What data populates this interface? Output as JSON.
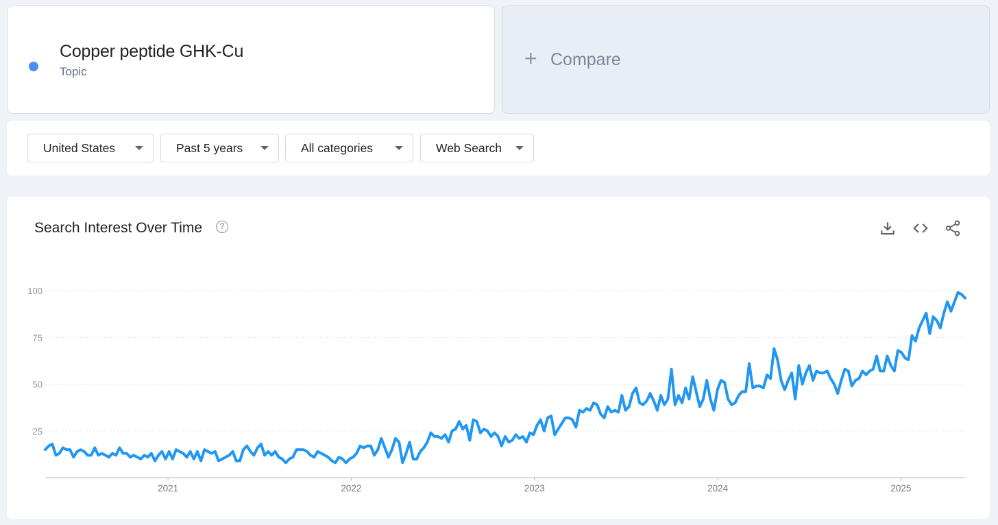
{
  "term": {
    "title": "Copper peptide GHK-Cu",
    "subtitle": "Topic",
    "color": "#4d8ef1"
  },
  "compare": {
    "plus": "+",
    "label": "Compare"
  },
  "filters": {
    "region": "United States",
    "period": "Past 5 years",
    "category": "All categories",
    "search_type": "Web Search"
  },
  "chart_header": {
    "title": "Search Interest Over Time",
    "help_icon": "question-circle-icon",
    "tools": [
      "download-icon",
      "embed-code-icon",
      "share-icon"
    ]
  },
  "chart_data": {
    "type": "line",
    "title": "Search Interest Over Time",
    "xlabel": "",
    "ylabel": "",
    "ylim": [
      0,
      100
    ],
    "yticks": [
      25,
      50,
      75,
      100
    ],
    "xticks": [
      "2021",
      "2022",
      "2023",
      "2024",
      "2025"
    ],
    "x_start": 2020.33,
    "x_end": 2025.35,
    "grid": true,
    "color": "#2196f3",
    "series": [
      {
        "values": [
          15,
          17,
          18,
          12,
          13,
          16,
          15,
          15,
          11,
          14,
          15,
          14,
          12,
          12,
          16,
          12,
          13,
          12,
          11,
          13,
          12,
          16,
          13,
          13,
          11,
          12,
          11,
          10,
          12,
          11,
          13,
          9,
          12,
          14,
          10,
          14,
          10,
          15,
          14,
          13,
          11,
          14,
          10,
          14,
          9,
          15,
          14,
          13,
          14,
          9,
          10,
          11,
          12,
          14,
          9,
          9,
          15,
          17,
          14,
          12,
          16,
          18,
          12,
          14,
          12,
          14,
          11,
          10,
          8,
          10,
          11,
          15,
          15,
          15,
          14,
          12,
          11,
          14,
          13,
          12,
          11,
          9,
          8,
          11,
          10,
          8,
          10,
          11,
          13,
          17,
          16,
          17,
          17,
          12,
          15,
          21,
          16,
          11,
          15,
          21,
          19,
          8,
          13,
          19,
          10,
          10,
          14,
          16,
          19,
          24,
          22,
          22,
          21,
          23,
          19,
          25,
          26,
          30,
          26,
          28,
          20,
          31,
          30,
          24,
          26,
          25,
          22,
          24,
          22,
          17,
          22,
          19,
          20,
          23,
          21,
          22,
          19,
          24,
          23,
          28,
          31,
          25,
          32,
          33,
          23,
          26,
          29,
          32,
          32,
          31,
          27,
          36,
          35,
          37,
          36,
          40,
          39,
          34,
          32,
          38,
          35,
          36,
          35,
          44,
          36,
          38,
          45,
          48,
          40,
          39,
          41,
          45,
          41,
          36,
          44,
          39,
          42,
          58,
          39,
          44,
          40,
          48,
          42,
          54,
          46,
          38,
          42,
          52,
          42,
          36,
          47,
          52,
          51,
          42,
          39,
          40,
          44,
          46,
          46,
          61,
          48,
          49,
          49,
          48,
          55,
          53,
          69,
          63,
          52,
          47,
          52,
          56,
          42,
          60,
          50,
          56,
          60,
          52,
          57,
          56,
          56,
          57,
          53,
          50,
          45,
          52,
          58,
          57,
          49,
          52,
          53,
          57,
          55,
          57,
          58,
          65,
          57,
          57,
          65,
          60,
          57,
          68,
          67,
          64,
          63,
          76,
          73,
          80,
          84,
          88,
          77,
          86,
          84,
          80,
          88,
          94,
          89,
          94,
          99,
          98,
          96
        ]
      }
    ]
  }
}
